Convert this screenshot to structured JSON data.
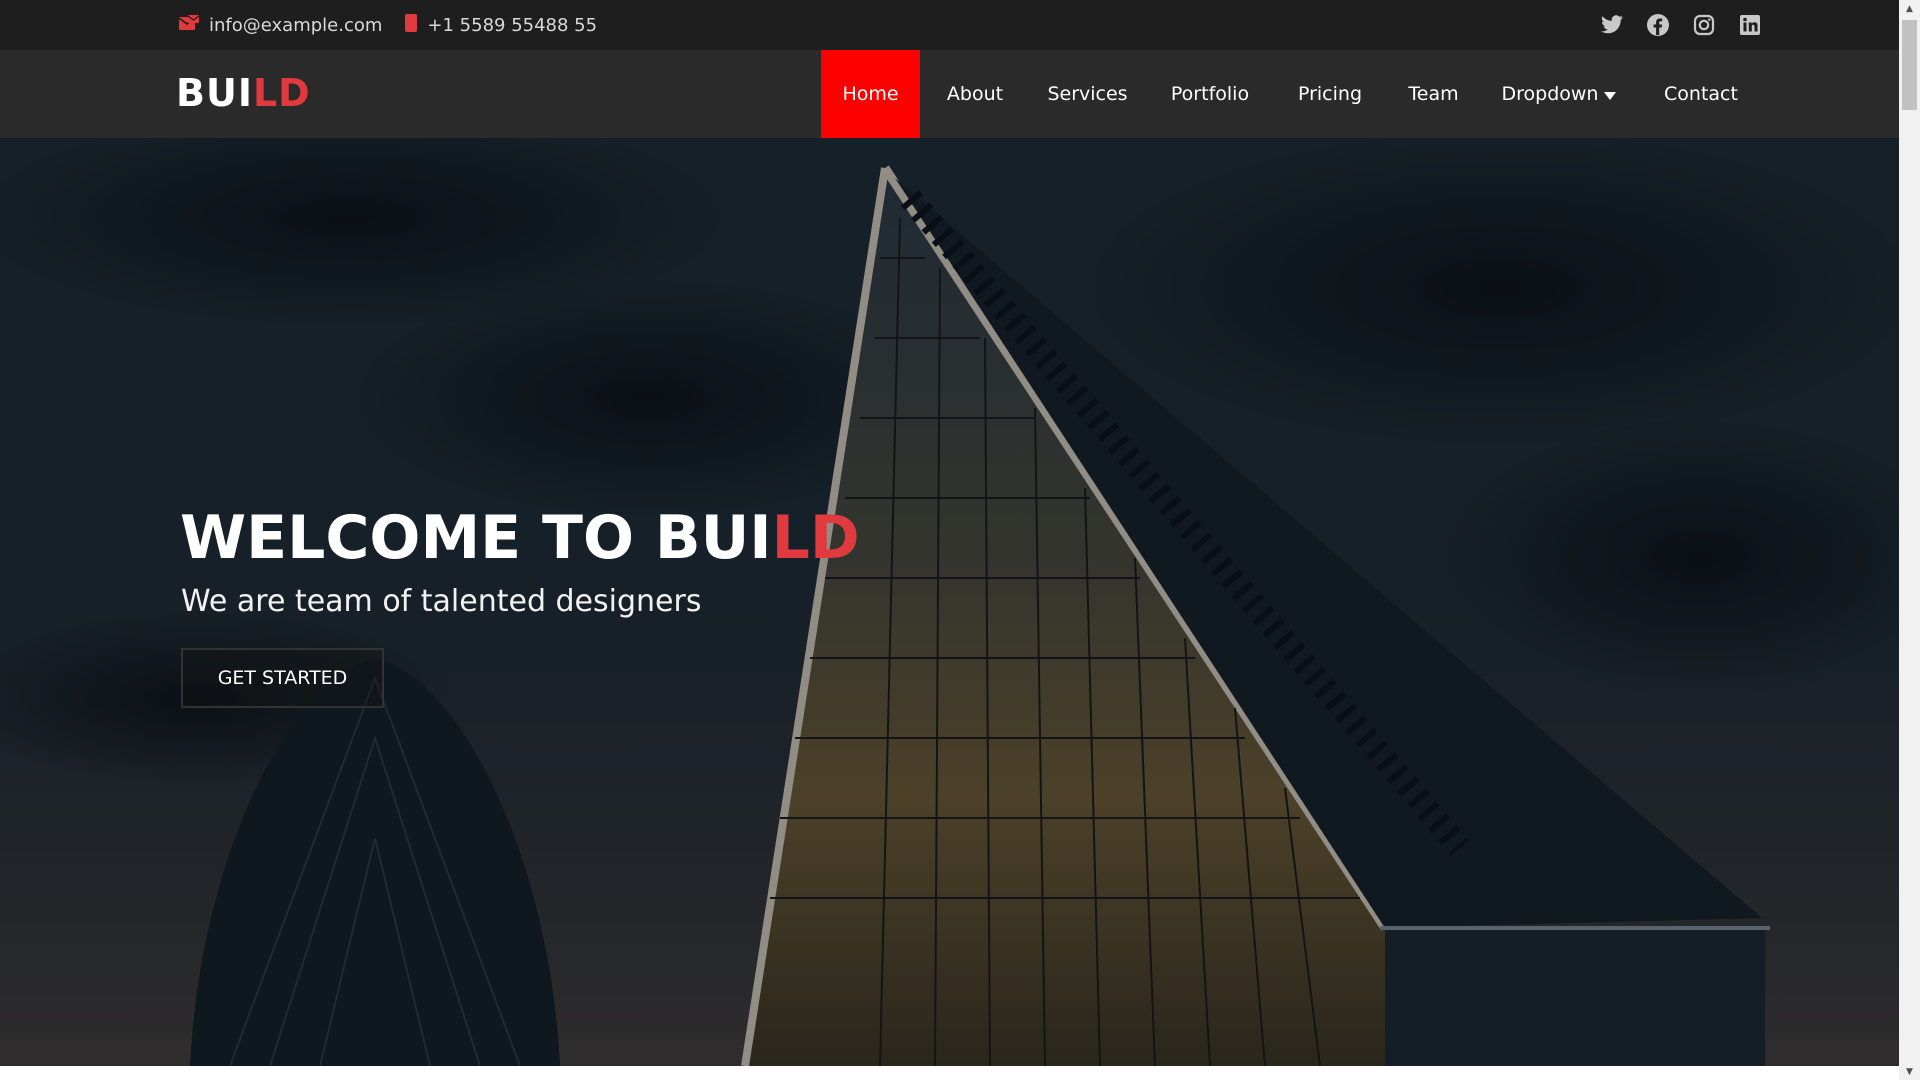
{
  "topbar": {
    "email": "info@example.com",
    "phone": "+1 5589 55488 55",
    "social": [
      "twitter-icon",
      "facebook-icon",
      "instagram-icon",
      "linkedin-icon"
    ]
  },
  "brand": {
    "logo_part1": "BUI",
    "logo_part2": "LD"
  },
  "nav": {
    "items": [
      {
        "label": "Home",
        "active": true
      },
      {
        "label": "About"
      },
      {
        "label": "Services"
      },
      {
        "label": "Portfolio"
      },
      {
        "label": "Pricing"
      },
      {
        "label": "Team"
      },
      {
        "label": "Dropdown",
        "has_caret": true
      },
      {
        "label": "Contact"
      }
    ]
  },
  "hero": {
    "title_part1": "WELCOME TO BUI",
    "title_part2": "LD",
    "subtitle": "We are team of talented designers",
    "cta": "GET STARTED"
  },
  "colors": {
    "accent": "#e03a3e",
    "active_nav": "#ff0000",
    "topbar_bg": "#1e1e1e",
    "nav_bg": "#2a2a2a"
  }
}
